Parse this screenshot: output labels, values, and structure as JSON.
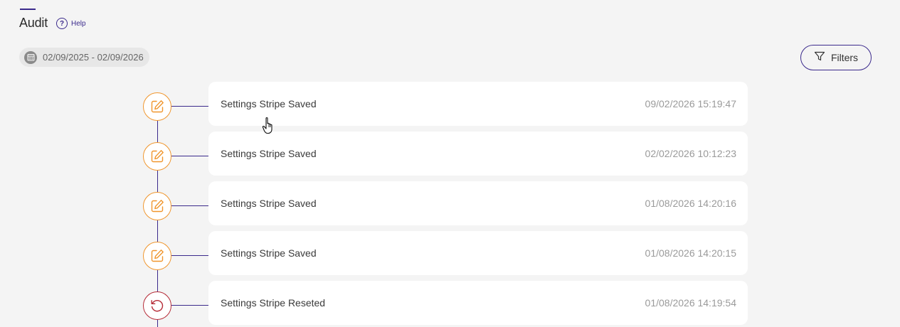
{
  "header": {
    "title": "Audit",
    "help_label": "Help",
    "help_glyph": "?"
  },
  "date_range": {
    "label": "02/09/2025 - 02/09/2026",
    "icon": "calendar-icon"
  },
  "filters": {
    "label": "Filters",
    "icon": "funnel-icon"
  },
  "colors": {
    "accent": "#3b2a8c",
    "edit_event": "#f0962d",
    "reset_event": "#b52a36",
    "background": "#f4f4f4"
  },
  "entries": [
    {
      "title": "Settings Stripe Saved",
      "timestamp": "09/02/2026 15:19:47",
      "icon": "edit-icon"
    },
    {
      "title": "Settings Stripe Saved",
      "timestamp": "02/02/2026 10:12:23",
      "icon": "edit-icon"
    },
    {
      "title": "Settings Stripe Saved",
      "timestamp": "01/08/2026 14:20:16",
      "icon": "edit-icon"
    },
    {
      "title": "Settings Stripe Saved",
      "timestamp": "01/08/2026 14:20:15",
      "icon": "edit-icon"
    },
    {
      "title": "Settings Stripe Reseted",
      "timestamp": "01/08/2026 14:19:54",
      "icon": "reset-icon"
    }
  ]
}
